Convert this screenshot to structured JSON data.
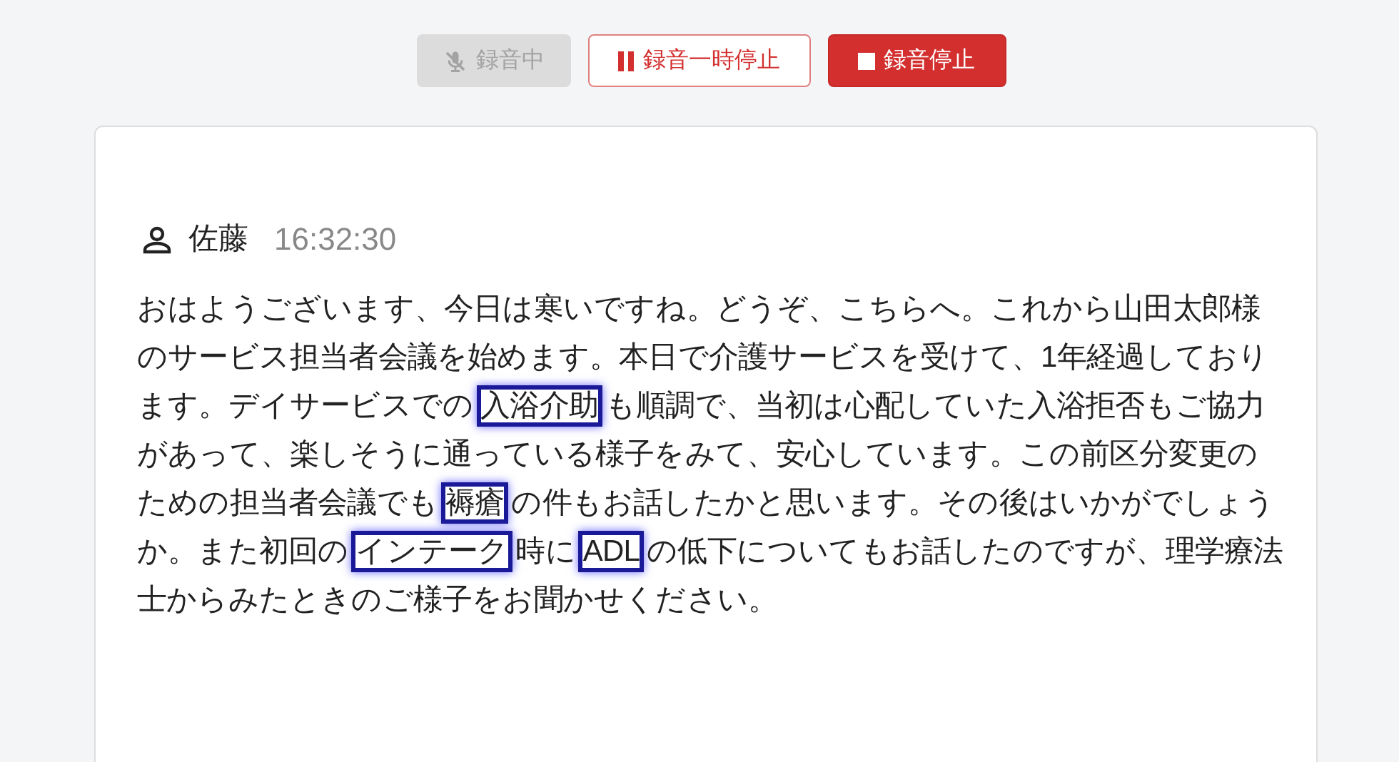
{
  "controls": [
    {
      "kind": "mic",
      "label": "録音中",
      "disabled": true
    },
    {
      "kind": "pause",
      "label": "録音一時停止",
      "disabled": false
    },
    {
      "kind": "stop",
      "label": "録音停止",
      "disabled": false
    }
  ],
  "message": {
    "speaker": "佐藤",
    "time": "16:32:30",
    "segments": [
      {
        "text": "おはようございます、今日は寒いですね。どうぞ、こちらへ。これから山田太郎様のサービス担当者会議を始めます。本日で介護サービスを受けて、1年経過しております。デイサービスでの",
        "highlighted": false
      },
      {
        "text": "入浴介助",
        "highlighted": true
      },
      {
        "text": "も順調で、当初は心配していた入浴拒否もご協力があって、楽しそうに通っている様子をみて、安心しています。この前区分変更のための担当者会議でも",
        "highlighted": false
      },
      {
        "text": "褥瘡",
        "highlighted": true
      },
      {
        "text": "の件もお話したかと思います。その後はいかがでしょうか。また初回の",
        "highlighted": false
      },
      {
        "text": "インテーク",
        "highlighted": true
      },
      {
        "text": "時に",
        "highlighted": false
      },
      {
        "text": "ADL",
        "highlighted": true
      },
      {
        "text": "の低下についてもお話したのですが、理学療法士からみたときのご様子をお聞かせください。",
        "highlighted": false
      }
    ]
  }
}
